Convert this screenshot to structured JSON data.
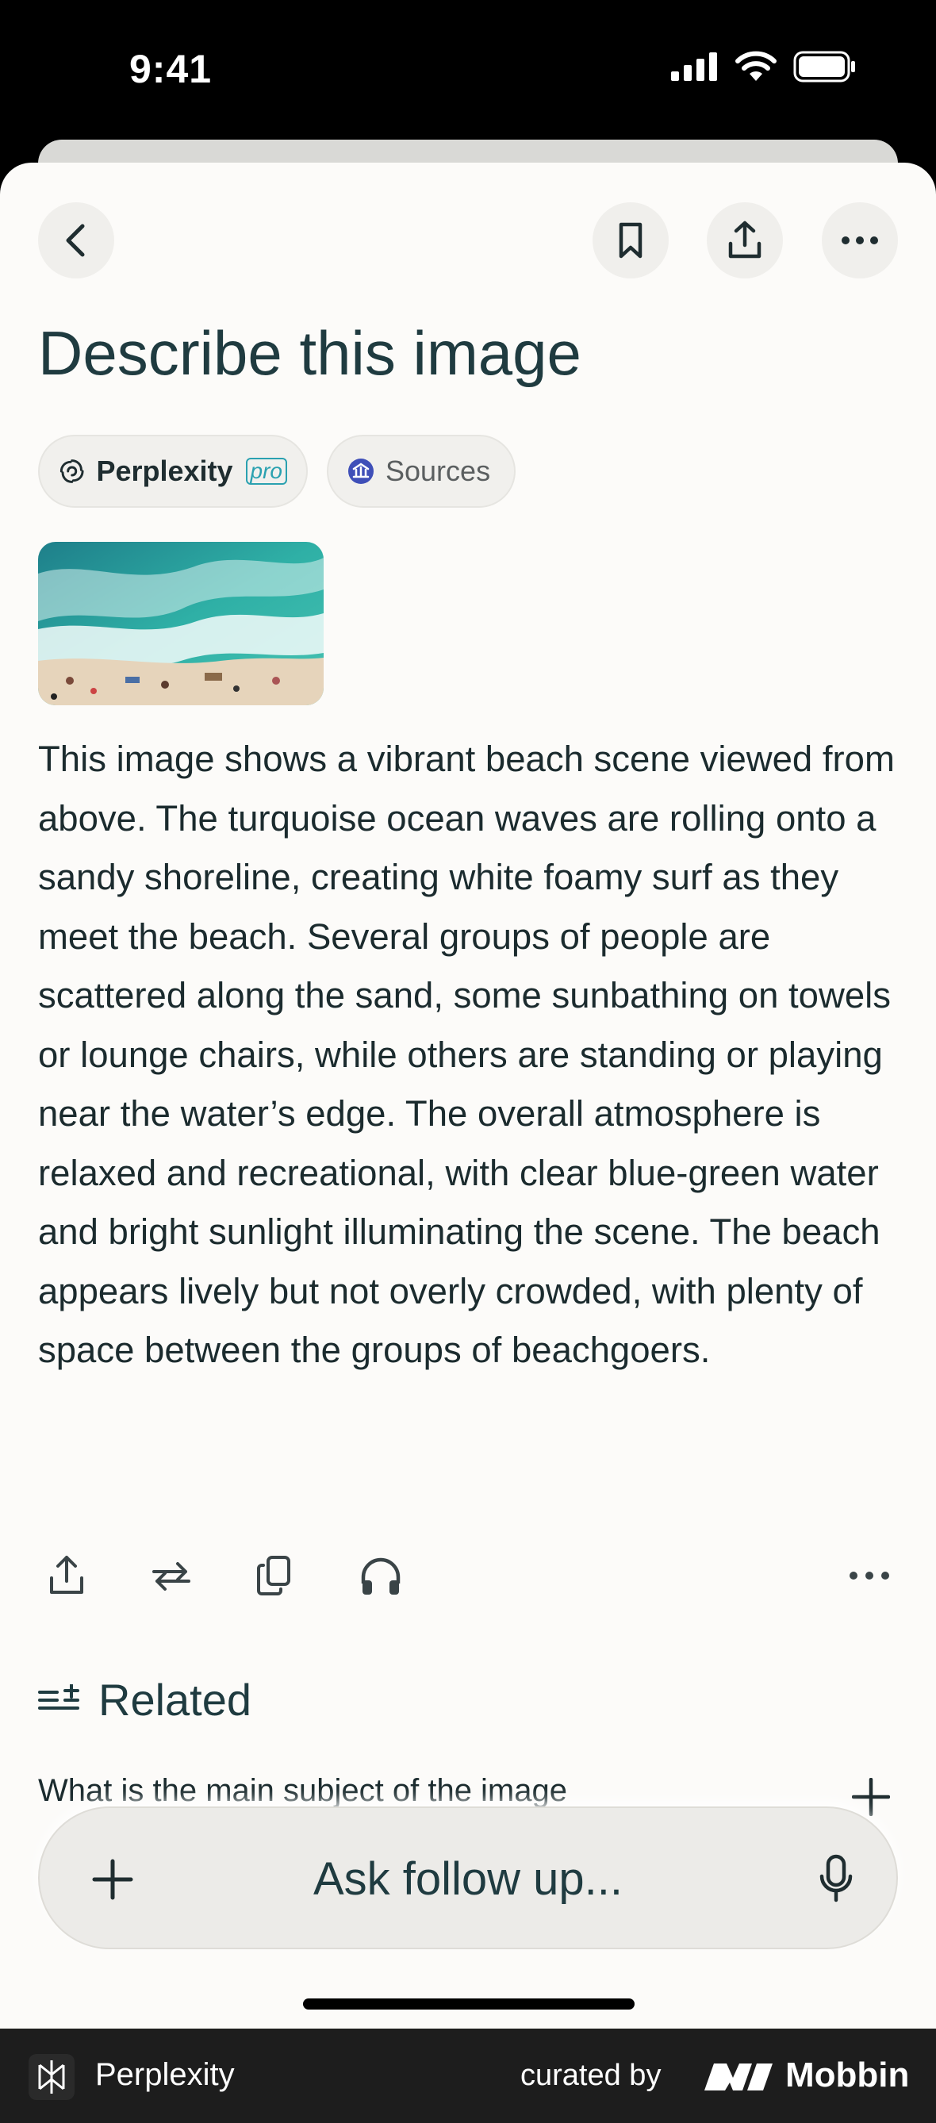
{
  "status_bar": {
    "time": "9:41"
  },
  "page": {
    "title": "Describe this image"
  },
  "chips": {
    "model_label": "Perplexity",
    "model_badge": "pro",
    "sources_label": "Sources"
  },
  "answer": {
    "text": "This image shows a vibrant beach scene viewed from above. The turquoise ocean waves are rolling onto a sandy shoreline, creating white foamy surf as they meet the beach. Several groups of people are scattered along the sand, some sunbathing on towels or lounge chairs, while others are standing or playing near the water’s edge. The overall atmosphere is relaxed and recreational, with clear blue-green water and bright sunlight illuminating the scene. The beach appears lively but not overly crowded, with plenty of space between the groups of beachgoers."
  },
  "related": {
    "heading": "Related",
    "items": [
      {
        "label": "What is the main subject of the image"
      }
    ]
  },
  "composer": {
    "placeholder": "Ask follow up..."
  },
  "footer": {
    "app_name": "Perplexity",
    "curated_by": "curated by",
    "brand": "Mobbin"
  },
  "icons": {
    "back": "chevron-left-icon",
    "bookmark": "bookmark-icon",
    "share": "share-icon",
    "more": "more-icon",
    "rewrite": "rewrite-icon",
    "copy": "copy-icon",
    "listen": "headphones-icon",
    "add": "plus-icon",
    "mic": "microphone-icon"
  },
  "colors": {
    "accent_teal": "#2aa1b0",
    "title_text": "#1f3b40",
    "sheet_bg": "#fcfbf9"
  }
}
